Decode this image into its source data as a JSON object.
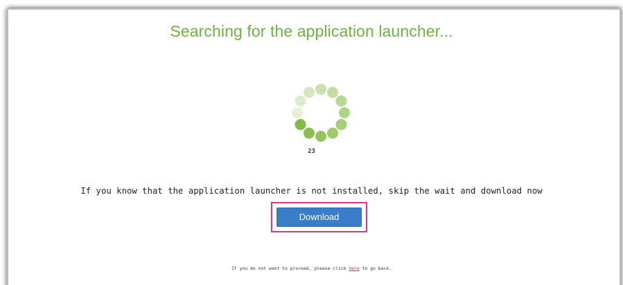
{
  "page": {
    "title": "Searching for the application launcher...",
    "countdown": "23",
    "message": "If you know that the application launcher is not installed, skip the wait and download now",
    "download_label": "Download",
    "back_prefix": "If you do not want to proceed, please click ",
    "back_link": "here",
    "back_suffix": " to go back."
  },
  "colors": {
    "title": "#6cb442",
    "button": "#3a7dc9",
    "highlight": "#e0338e",
    "spinner_dark": "#7fbc41",
    "spinner_light": "#e6f2d6"
  },
  "spinner": {
    "dot_count": 12
  }
}
